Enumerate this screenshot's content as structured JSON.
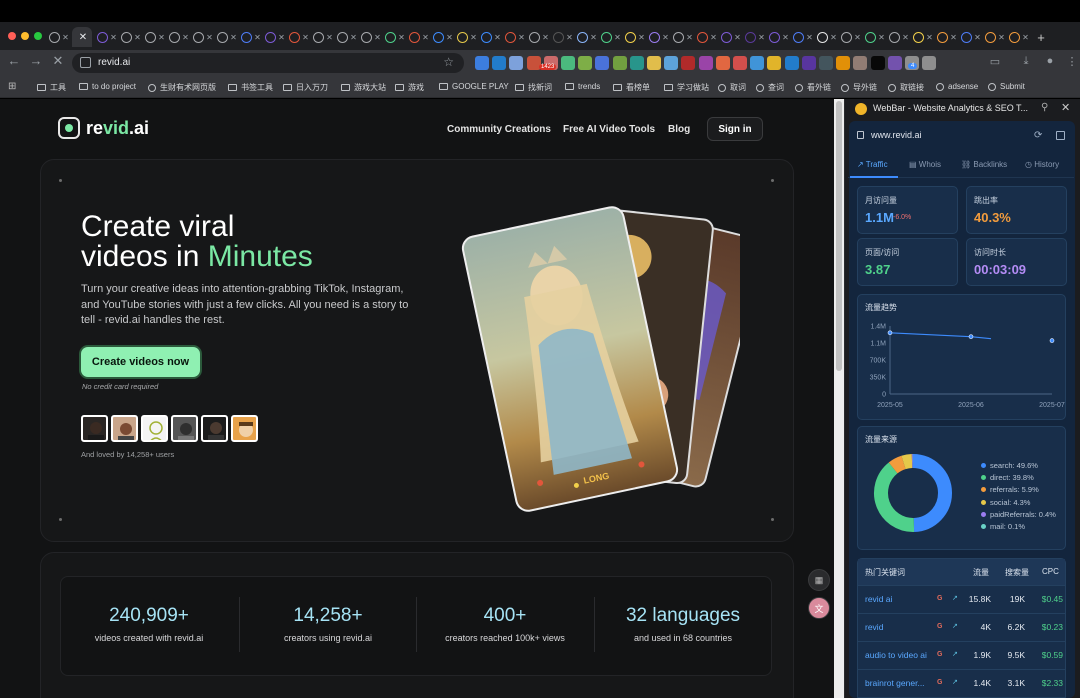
{
  "browser": {
    "address": "revid.ai",
    "bookmarks": [
      "工具",
      "to do project",
      "生财有术网页版",
      "书签工具",
      "日入万刀",
      "游戏大站",
      "游戏",
      "GOOGLE PLAY",
      "找新词",
      "trends",
      "看榜单",
      "学习做站",
      "取词",
      "查词",
      "看外链",
      "导外链",
      "取链接",
      "adsense",
      "Submit"
    ],
    "ext_badges": {
      "gmail": "1423",
      "puzzle": "4"
    }
  },
  "site": {
    "logo_text_a": "re",
    "logo_text_b": "vid",
    "logo_text_c": ".ai",
    "nav": [
      "Community Creations",
      "Free AI Video Tools",
      "Blog"
    ],
    "signin": "Sign in",
    "hero_line1": "Create viral",
    "hero_line2a": "videos in ",
    "hero_line2b": "Minutes",
    "description": "Turn your creative ideas into attention-grabbing TikTok, Instagram, and YouTube stories with just a few clicks. All you need is a story to tell - revid.ai handles the rest.",
    "cta": "Create videos now",
    "no_cc": "No credit card required",
    "loved": "And loved by 14,258+ users",
    "card_label": "LONG",
    "stats": [
      {
        "num": "240,909+",
        "label": "videos created with revid.ai"
      },
      {
        "num": "14,258+",
        "label": "creators using revid.ai"
      },
      {
        "num": "400+",
        "label": "creators reached 100k+ views"
      },
      {
        "num": "32 languages",
        "label": "and used in 68 countries"
      }
    ]
  },
  "panel": {
    "title": "WebBar - Website Analytics & SEO T...",
    "url": "www.revid.ai",
    "tabs": [
      "Traffic",
      "Whois",
      "Backlinks",
      "History"
    ],
    "metrics": [
      {
        "label": "月访问量",
        "value": "1.1M",
        "delta": "-6.0%",
        "color": "#5aa8ff"
      },
      {
        "label": "跳出率",
        "value": "40.3%",
        "color": "#f39c3d"
      },
      {
        "label": "页面/访问",
        "value": "3.87",
        "color": "#4fd18b"
      },
      {
        "label": "访问时长",
        "value": "00:03:09",
        "color": "#b48cf5"
      }
    ],
    "trend_title": "流量趋势",
    "source_title": "流量来源",
    "legend": [
      {
        "label": "search: 49.6%",
        "color": "#3d8bfd"
      },
      {
        "label": "direct: 39.8%",
        "color": "#4fd18b"
      },
      {
        "label": "referrals: 5.9%",
        "color": "#f39c3d"
      },
      {
        "label": "social: 4.3%",
        "color": "#e5c84a"
      },
      {
        "label": "paidReferrals: 0.4%",
        "color": "#9b7cf0"
      },
      {
        "label": "mail: 0.1%",
        "color": "#6ad1c6"
      }
    ],
    "kw_header": [
      "热门关键词",
      "流量",
      "搜索量",
      "CPC"
    ],
    "keywords": [
      {
        "kw": "revid ai",
        "traffic": "15.8K",
        "volume": "19K",
        "cpc": "$0.45"
      },
      {
        "kw": "revid",
        "traffic": "4K",
        "volume": "6.2K",
        "cpc": "$0.23"
      },
      {
        "kw": "audio to video ai",
        "traffic": "1.9K",
        "volume": "9.5K",
        "cpc": "$0.59"
      },
      {
        "kw": "brainrot gener...",
        "traffic": "1.4K",
        "volume": "3.1K",
        "cpc": "$2.33"
      }
    ]
  },
  "chart_data": [
    {
      "type": "line",
      "title": "流量趋势",
      "x": [
        "2025-05",
        "2025-06",
        "2025-07"
      ],
      "series": [
        {
          "values": [
            1260000,
            1180000,
            1100000
          ]
        }
      ],
      "ylim": [
        0,
        1400000
      ],
      "yticks": [
        "0",
        "350K",
        "700K",
        "1.1M",
        "1.4M"
      ]
    },
    {
      "type": "pie",
      "title": "流量来源",
      "categories": [
        "search",
        "direct",
        "referrals",
        "social",
        "paidReferrals",
        "mail"
      ],
      "values": [
        49.6,
        39.8,
        5.9,
        4.3,
        0.4,
        0.1
      ]
    }
  ]
}
